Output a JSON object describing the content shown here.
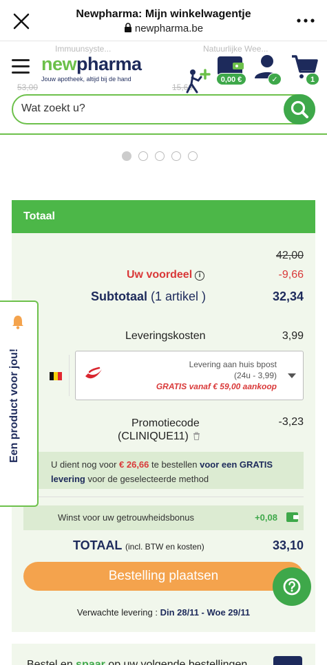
{
  "browser": {
    "title": "Newpharma: Mijn winkelwagentje",
    "url": "newpharma.be"
  },
  "header": {
    "bg_texts": [
      "Immuunsyste...",
      "Natuurlijke Wee...",
      "53,00",
      "15,60"
    ],
    "logo_new": "new",
    "logo_pharma": "pharma",
    "logo_tagline": "Jouw apotheek, altijd bij de hand",
    "wallet_badge": "0,00 €",
    "account_badge": "✓",
    "cart_badge": "1",
    "search_placeholder": "Wat zoekt u?"
  },
  "carousel": {
    "count": 5,
    "active": 0
  },
  "totals": {
    "heading": "Totaal",
    "original_price": "42,00",
    "voordeel_label": "Uw voordeel",
    "voordeel_value": "-9,66",
    "subtotal_label": "Subtotaal",
    "subtotal_count": "(1 artikel )",
    "subtotal_value": "32,34",
    "shipping_label": "Leveringskosten",
    "shipping_value": "3,99",
    "delivery_option_line1": "Levering aan huis bpost",
    "delivery_option_line2": "(24u - 3,99)",
    "delivery_option_line3": "GRATIS vanaf € 59,00 aankoop",
    "promo_label": "Promotiecode",
    "promo_code": "(CLINIQUE11)",
    "promo_value": "-3,23",
    "notice_part1": "U dient nog voor ",
    "notice_amount": "€ 26,66",
    "notice_part2": " te bestellen ",
    "notice_bold1": "voor een GRATIS",
    "notice_bold2": "levering",
    "notice_part3": " voor de geselecteerde method",
    "bonus_label": "Winst voor uw getrouwheidsbonus",
    "bonus_value": "+0,08",
    "total_label": "TOTAAL",
    "total_sub": "(incl. BTW en kosten)",
    "total_value": "33,10",
    "order_button": "Bestelling plaatsen",
    "eta_label": "Verwachte levering : ",
    "eta_value": "Din 28/11 - Woe 29/11"
  },
  "side_tab": "Een product voor jou!",
  "bottom": {
    "text1": "Bestel en ",
    "text_green": "spaar",
    "text2": " op uw volgende bestellingen"
  },
  "colors": {
    "brand_green": "#6cc04a",
    "brand_navy": "#1d2a5b",
    "price_red": "#d93838",
    "cta_orange": "#f4a34d"
  }
}
